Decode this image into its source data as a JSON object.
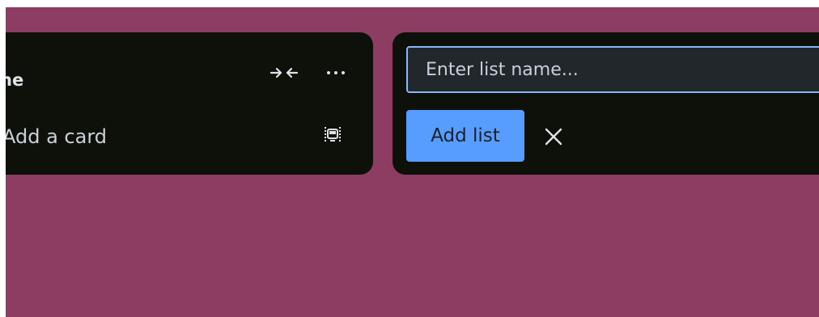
{
  "colors": {
    "board_background": "#8d3d62",
    "list_background": "#0d110a",
    "input_background": "#22272b",
    "input_focus_border": "#85b8ff",
    "primary_button": "#579dff",
    "text": "#dfe3e6"
  },
  "list": {
    "title": "ne",
    "collapse_icon": "collapse-arrows-icon",
    "more_icon": "more-options-icon",
    "add_card_label": "Add a card",
    "template_icon": "card-template-icon"
  },
  "composer": {
    "input_value": "",
    "input_placeholder": "Enter list name...",
    "add_button_label": "Add list",
    "close_icon": "close-icon"
  }
}
